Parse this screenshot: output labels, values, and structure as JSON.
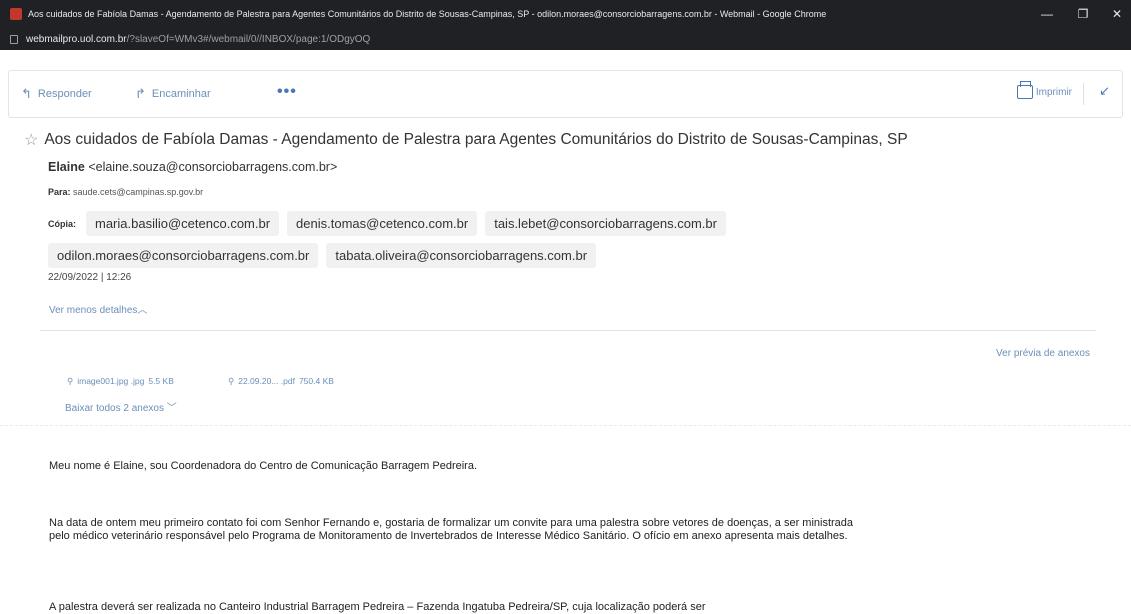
{
  "window": {
    "title": "Aos cuidados de Fabíola Damas - Agendamento de Palestra para Agentes Comunitários do Distrito de Sousas-Campinas, SP - odilon.moraes@consorciobarragens.com.br - Webmail - Google Chrome",
    "url_host": "webmailpro.uol.com.br",
    "url_path": "/?slaveOf=WMv3#/webmail/0//INBOX/page:1/ODgyOQ"
  },
  "toolbar": {
    "reply": "Responder",
    "forward": "Encaminhar",
    "more": "•••",
    "print": "Imprimir"
  },
  "message": {
    "subject": "Aos cuidados de Fabíola Damas - Agendamento de Palestra para Agentes Comunitários do Distrito de Sousas-Campinas, SP",
    "sender_name": "Elaine",
    "sender_email": "<elaine.souza@consorciobarragens.com.br>",
    "to_label": "Para:",
    "to": "saude.cets@campinas.sp.gov.br",
    "cc_label": "Cópia:",
    "cc": [
      "maria.basilio@cetenco.com.br",
      "denis.tomas@cetenco.com.br",
      "tais.lebet@consorciobarragens.com.br",
      "odilon.moraes@consorciobarragens.com.br",
      "tabata.oliveira@consorciobarragens.com.br"
    ],
    "date": "22/09/2022 | 12:26",
    "less_details": "Ver menos detalhes"
  },
  "attachments": {
    "preview_link": "Ver prévia de anexos",
    "items": [
      {
        "name": "image001.jpg .jpg",
        "size": "5.5 KB"
      },
      {
        "name": "22.09.20... .pdf",
        "size": "750.4 KB"
      }
    ],
    "download_all": "Baixar todos 2 anexos"
  },
  "body": {
    "p1": "Meu nome é Elaine, sou Coordenadora do Centro de Comunicação Barragem Pedreira.",
    "p2": "Na data de ontem meu primeiro contato foi com Senhor Fernando e, gostaria de formalizar um convite para uma palestra sobre vetores de doenças, a ser ministrada pelo médico veterinário responsável pelo Programa de Monitoramento de Invertebrados de Interesse Médico Sanitário. O ofício em anexo apresenta mais detalhes.",
    "p3": "A palestra deverá ser realizada no Canteiro Industrial Barragem Pedreira – Fazenda Ingatuba Pedreira/SP, cuja localização poderá ser"
  }
}
